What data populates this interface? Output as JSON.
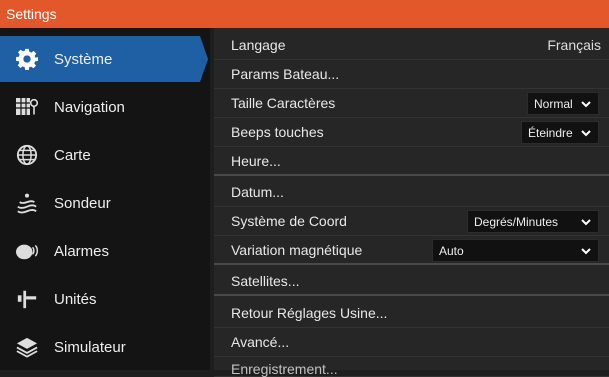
{
  "window": {
    "title": "Settings"
  },
  "sidebar": {
    "items": [
      {
        "label": "Système",
        "icon": "gear-icon",
        "active": true
      },
      {
        "label": "Navigation",
        "icon": "waypoint-grid-icon",
        "active": false
      },
      {
        "label": "Carte",
        "icon": "globe-icon",
        "active": false
      },
      {
        "label": "Sondeur",
        "icon": "sonar-icon",
        "active": false
      },
      {
        "label": "Alarmes",
        "icon": "alarm-icon",
        "active": false
      },
      {
        "label": "Unités",
        "icon": "ruler-icon",
        "active": false
      },
      {
        "label": "Simulateur",
        "icon": "layers-icon",
        "active": false
      }
    ]
  },
  "settings": {
    "langage": {
      "label": "Langage",
      "value": "Français"
    },
    "params_bateau": {
      "label": "Params Bateau..."
    },
    "taille_caracteres": {
      "label": "Taille Caractères",
      "value": "Normal"
    },
    "beeps_touches": {
      "label": "Beeps touches",
      "value": "Éteindre"
    },
    "heure": {
      "label": "Heure..."
    },
    "datum": {
      "label": "Datum..."
    },
    "systeme_coord": {
      "label": "Système de Coord",
      "value": "Degrés/Minutes"
    },
    "variation_magnetique": {
      "label": "Variation magnétique",
      "value": "Auto"
    },
    "satellites": {
      "label": "Satellites..."
    },
    "retour_reglages": {
      "label": "Retour Réglages Usine..."
    },
    "avance": {
      "label": "Avancé..."
    },
    "enregistrement": {
      "label": "Enregistrement..."
    }
  },
  "colors": {
    "titlebar": "#e2582a",
    "active_nav": "#1f5fa3",
    "sidebar_bg": "#141414",
    "content_bg": "#262626"
  }
}
